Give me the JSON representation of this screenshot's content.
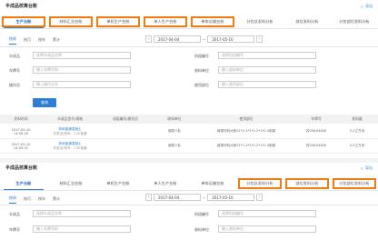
{
  "top": {
    "title": "半成品核算台账",
    "export": "导出",
    "tabs": [
      "生产台账",
      "材料汇总台账",
      "单机生产台账",
      "单人生产台账",
      "单车运输台账",
      "分包队发料分析",
      "部位发料分析",
      "分包部位发料分析"
    ],
    "subtabs": [
      "按周",
      "按月",
      "按年",
      "累计"
    ],
    "date_from": "2017-04-04",
    "date_to": "2017-05-10",
    "filters": {
      "product_label": "半成品",
      "product_placeholder": "选择半成品名称",
      "machine_label": "机组编号",
      "machine_placeholder": "选择机组编号",
      "car_label": "车牌号",
      "car_placeholder": "输入车牌号码",
      "recv_label": "收料单位",
      "recv_placeholder": "输入收料单位",
      "operator_label": "操作员",
      "operator_placeholder": "输入操作员名",
      "part_label": "使用部位",
      "part_placeholder": "输入使用部位"
    },
    "query": "查询",
    "columns": [
      "发料时间",
      "半成品型号/规格",
      "机组编号/操作员",
      "收料单位",
      "使用部位",
      "车牌号",
      "发料量"
    ],
    "rows": [
      {
        "time": "2017-05-10",
        "time2": "14:09:20",
        "spec": "拌和普通混凝土",
        "spec2": "非泵送/型号：C30普通",
        "machine": "",
        "unit": "钢混六队",
        "part": "敦源河特大桥21*2-2*1*2.2*1*2-4制梁",
        "car": "苏G5KU4830",
        "qty": "5.2立方米"
      },
      {
        "time": "2017-05-10",
        "time2": "14:05:31",
        "spec": "拌和普通混凝土",
        "spec2": "非泵送/型号：C30普通",
        "machine": "",
        "unit": "钢混六队",
        "part": "敦源河特大桥21*1-2*1*2.2*1*2-4制梁",
        "car": "苏G5KU4830",
        "qty": "5.5立方米"
      }
    ]
  },
  "bottom": {
    "title": "半成品核算台账",
    "export": "导出",
    "tabs": [
      "生产台账",
      "材料汇总台账",
      "单机生产台账",
      "单人生产台账",
      "单车运输台账",
      "分包队发料分析",
      "部位发料分析",
      "分包部位发料分析"
    ],
    "subtabs": [
      "按周",
      "按月",
      "按年",
      "累计"
    ],
    "date_from": "2017-04-04",
    "date_to": "2017-05-10",
    "filters": {
      "product_label": "半成品",
      "product_placeholder": "选择半成品名称",
      "machine_label": "机组编号",
      "machine_placeholder": "选择机组编号",
      "car_label": "车牌号",
      "car_placeholder": "输入车牌号码",
      "recv_label": "收料单位",
      "recv_placeholder": "输入收料单位"
    }
  },
  "colors": {
    "accent": "#2f7fd0",
    "highlight": "#f07b12"
  }
}
